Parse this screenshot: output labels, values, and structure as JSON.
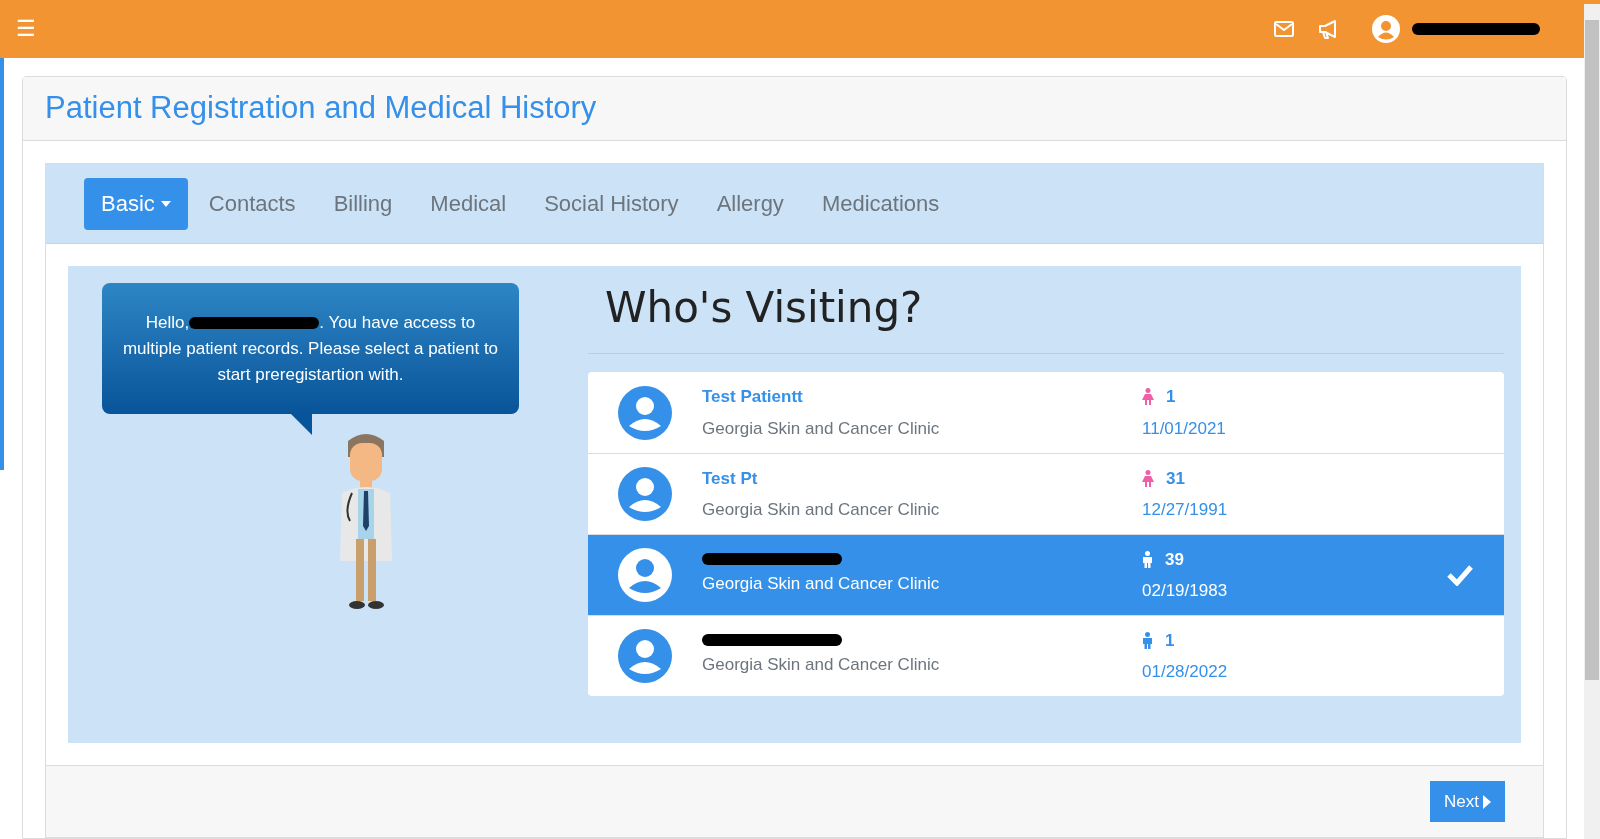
{
  "topbar": {
    "menu_icon": "☰",
    "user": {
      "name_redacted": true
    }
  },
  "page_title": "Patient Registration and Medical History",
  "tabs": [
    {
      "label": "Basic",
      "selected": true,
      "dropdown": true
    },
    {
      "label": "Contacts",
      "selected": false,
      "dropdown": false
    },
    {
      "label": "Billing",
      "selected": false,
      "dropdown": false
    },
    {
      "label": "Medical",
      "selected": false,
      "dropdown": false
    },
    {
      "label": "Social History",
      "selected": false,
      "dropdown": false
    },
    {
      "label": "Allergy",
      "selected": false,
      "dropdown": false
    },
    {
      "label": "Medications",
      "selected": false,
      "dropdown": false
    }
  ],
  "greeting": {
    "start": "Hello,",
    "name_redacted": true,
    "line1_rest": ". You have access to",
    "rest": "multiple patient records. Please select a patient to start preregistartion with."
  },
  "heading": "Who's Visiting?",
  "patients": [
    {
      "name": "Test Patientt",
      "name_redacted": false,
      "clinic": "Georgia Skin and Cancer Clinic",
      "kind": "female",
      "age": "1",
      "dob": "11/01/2021",
      "selected": false
    },
    {
      "name": "Test Pt",
      "name_redacted": false,
      "clinic": "Georgia Skin and Cancer Clinic",
      "kind": "female",
      "age": "31",
      "dob": "12/27/1991",
      "selected": false
    },
    {
      "name_redacted": true,
      "clinic": "Georgia Skin and Cancer Clinic",
      "kind": "male",
      "age": "39",
      "dob": "02/19/1983",
      "selected": true
    },
    {
      "name_redacted": true,
      "clinic": "Georgia Skin and Cancer Clinic",
      "kind": "male",
      "age": "1",
      "dob": "01/28/2022",
      "selected": false
    }
  ],
  "next_button": "Next"
}
